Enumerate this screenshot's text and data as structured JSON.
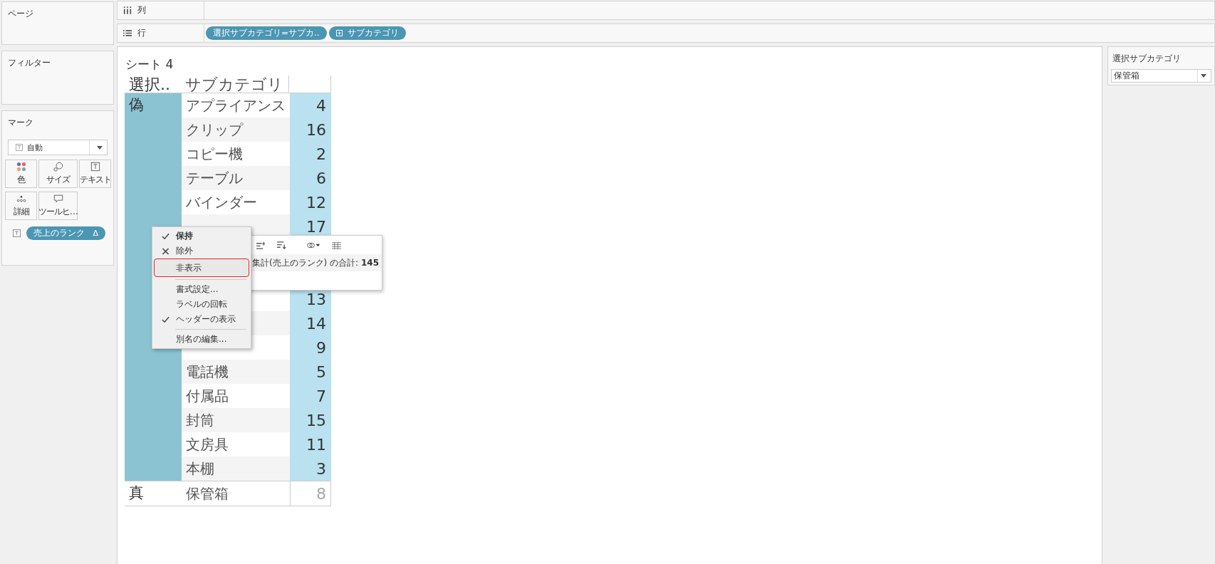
{
  "left_panel": {
    "pages": {
      "title": "ページ"
    },
    "filters": {
      "title": "フィルター"
    },
    "marks": {
      "title": "マーク",
      "mark_type": "自動",
      "buttons": [
        {
          "label": "色",
          "kind": "color"
        },
        {
          "label": "サイズ",
          "kind": "size"
        },
        {
          "label": "テキスト",
          "kind": "text"
        },
        {
          "label": "詳細",
          "kind": "detail"
        },
        {
          "label": "ツールヒ…",
          "kind": "tooltip"
        }
      ],
      "pill": {
        "label": "売上のランク",
        "delta": "Δ"
      }
    }
  },
  "shelves": {
    "columns": {
      "label": "列"
    },
    "rows": {
      "label": "行",
      "pills": [
        {
          "label": "選択サブカテゴリ=サブカ..",
          "expand": false
        },
        {
          "label": "サブカテゴリ",
          "expand": true
        }
      ]
    }
  },
  "sheet": {
    "title": "シート 4",
    "headers": [
      "選択..",
      "サブカテゴリ"
    ],
    "groups": [
      {
        "label": "偽",
        "highlighted": true,
        "rows": [
          {
            "name": "アプライアンス",
            "value": "4"
          },
          {
            "name": "クリップ",
            "value": "16"
          },
          {
            "name": "コピー機",
            "value": "2"
          },
          {
            "name": "テーブル",
            "value": "6"
          },
          {
            "name": "バインダー",
            "value": "12"
          },
          {
            "value": "17"
          },
          {},
          {},
          {
            "value": "13"
          },
          {
            "value": "14"
          },
          {
            "value": "9"
          },
          {
            "name": "電話機",
            "value": "5"
          },
          {
            "name": "付属品",
            "value": "7"
          },
          {
            "name": "封筒",
            "value": "15"
          },
          {
            "name": "文房具",
            "value": "11"
          },
          {
            "name": "本棚",
            "value": "3"
          }
        ]
      },
      {
        "label": "真",
        "highlighted": false,
        "rows": [
          {
            "name": "保管箱",
            "value": "8"
          }
        ]
      }
    ]
  },
  "tooltip": {
    "summary": "集計(売上のランク) の合計: **145**"
  },
  "context_menu": [
    {
      "kind": "item",
      "label": "保持",
      "checked": true,
      "excluded": false,
      "bold": true,
      "highlighted": false
    },
    {
      "kind": "item",
      "label": "除外",
      "checked": false,
      "excluded": true,
      "bold": false,
      "highlighted": false
    },
    {
      "kind": "item",
      "label": "非表示",
      "checked": false,
      "excluded": false,
      "bold": false,
      "highlighted": true
    },
    {
      "kind": "separator"
    },
    {
      "kind": "item",
      "label": "書式設定...",
      "checked": false,
      "excluded": false,
      "bold": false,
      "highlighted": false
    },
    {
      "kind": "item",
      "label": "ラベルの回転",
      "checked": false,
      "excluded": false,
      "bold": false,
      "highlighted": false
    },
    {
      "kind": "item",
      "label": "ヘッダーの表示",
      "checked": true,
      "excluded": false,
      "bold": false,
      "highlighted": false
    },
    {
      "kind": "separator"
    },
    {
      "kind": "item",
      "label": "別名の編集...",
      "checked": false,
      "excluded": false,
      "bold": false,
      "highlighted": false
    }
  ],
  "right_panel": {
    "filter": {
      "title": "選択サブカテゴリ",
      "value": "保管箱"
    }
  }
}
